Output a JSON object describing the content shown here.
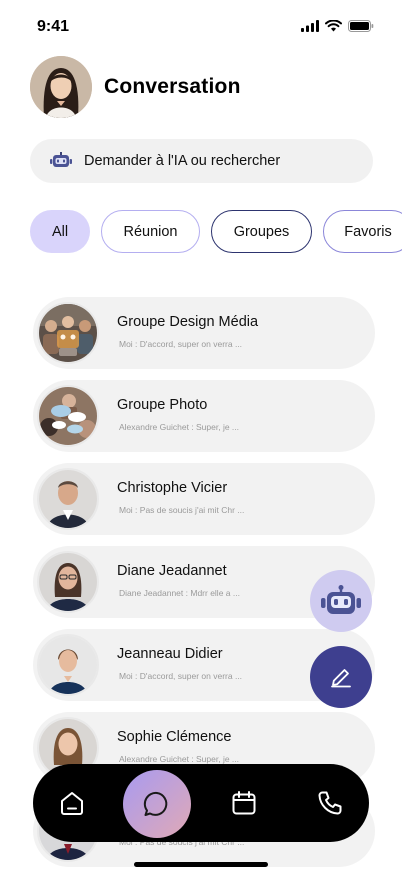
{
  "status_bar": {
    "time": "9:41"
  },
  "header": {
    "title": "Conversation"
  },
  "search": {
    "label": "Demander à l'IA ou rechercher"
  },
  "filters": [
    {
      "label": "All",
      "active": true
    },
    {
      "label": "Réunion",
      "active": false
    },
    {
      "label": "Groupes",
      "active": false
    },
    {
      "label": "Favoris",
      "active": false
    }
  ],
  "conversations": [
    {
      "name": "Groupe Design Média",
      "preview": "Moi : D'accord, super on verra ..."
    },
    {
      "name": "Groupe Photo",
      "preview": "Alexandre Guichet : Super, je ..."
    },
    {
      "name": "Christophe Vicier",
      "preview": "Moi : Pas de soucis j'ai mit Chr ..."
    },
    {
      "name": "Diane Jeadannet",
      "preview": "Diane Jeadannet : Mdrr elle  a ..."
    },
    {
      "name": "Jeanneau Didier",
      "preview": "Moi : D'accord, super on verra ..."
    },
    {
      "name": "Sophie Clémence",
      "preview": "Alexandre Guichet : Super, je ..."
    },
    {
      "name": "",
      "preview": "Moi : Pas de soucis j'ai mit Chr ..."
    }
  ],
  "colors": {
    "accent_chip": "#d9d4fb",
    "fab_ai": "#cfcbf0",
    "fab_edit": "#3e3f8f",
    "nav_bg": "#000000"
  },
  "icons": {
    "search": "robot-icon",
    "fab_ai": "robot-icon",
    "fab_edit": "pencil-icon",
    "nav": [
      "home-icon",
      "chat-icon",
      "calendar-icon",
      "phone-icon"
    ]
  }
}
